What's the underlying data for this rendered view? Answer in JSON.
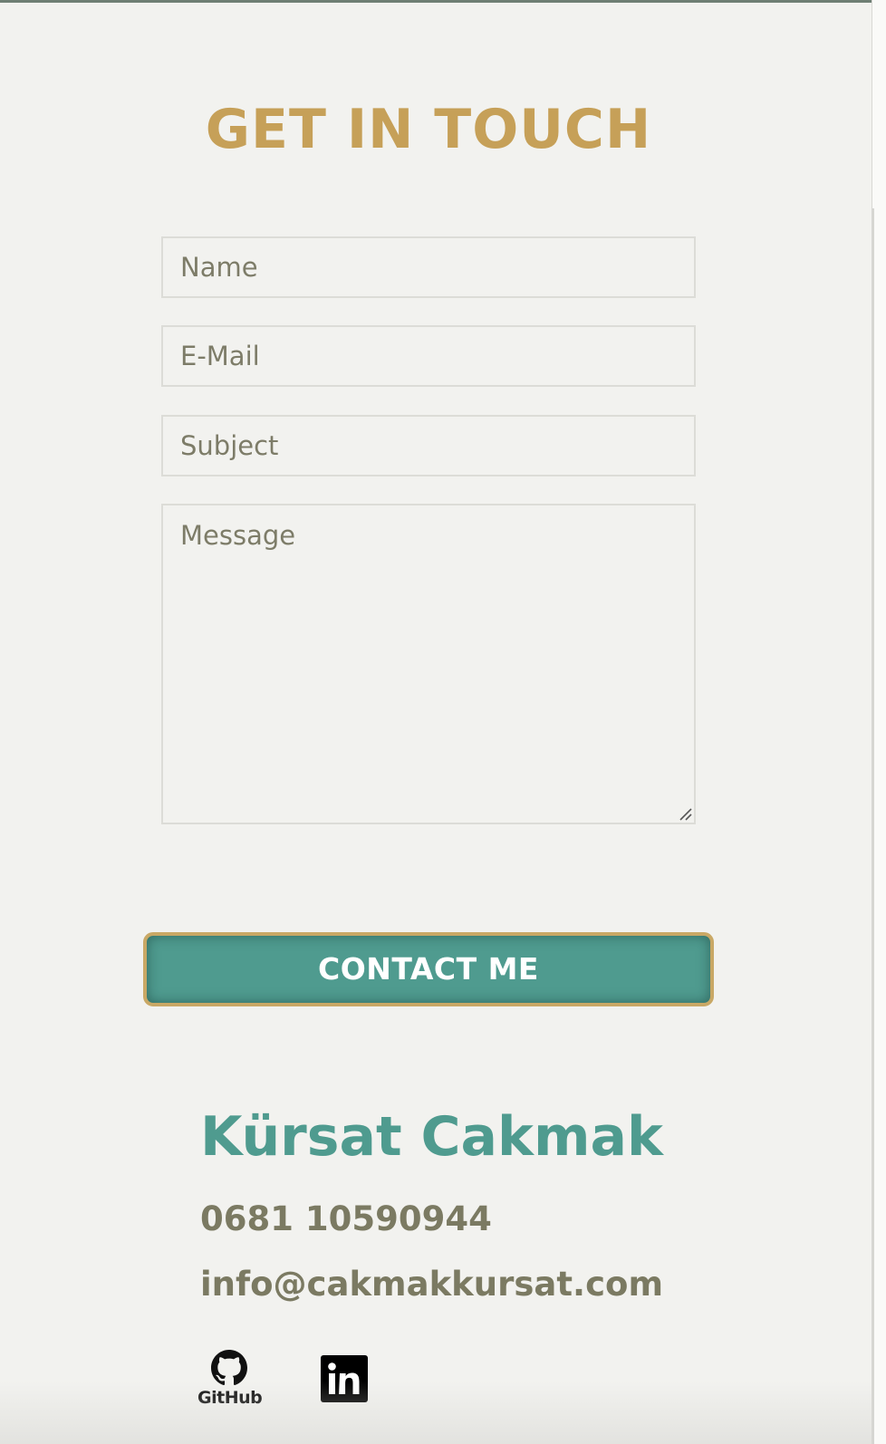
{
  "section": {
    "title": "GET IN TOUCH"
  },
  "form": {
    "name_placeholder": "Name",
    "email_placeholder": "E-Mail",
    "subject_placeholder": "Subject",
    "message_placeholder": "Message",
    "submit_label": "CONTACT ME"
  },
  "contact": {
    "name": "Kürsat Cakmak",
    "phone": "0681 10590944",
    "email": "info@cakmakkursat.com"
  },
  "social": {
    "github_label": "GitHub",
    "linkedin_label": "in",
    "github_icon": "github-icon",
    "linkedin_icon": "linkedin-icon"
  },
  "colors": {
    "title": "#c6a058",
    "accent": "#4f9b8f",
    "text": "#7b7a62",
    "button_border": "#c9a865",
    "background": "#f2f2ef"
  }
}
